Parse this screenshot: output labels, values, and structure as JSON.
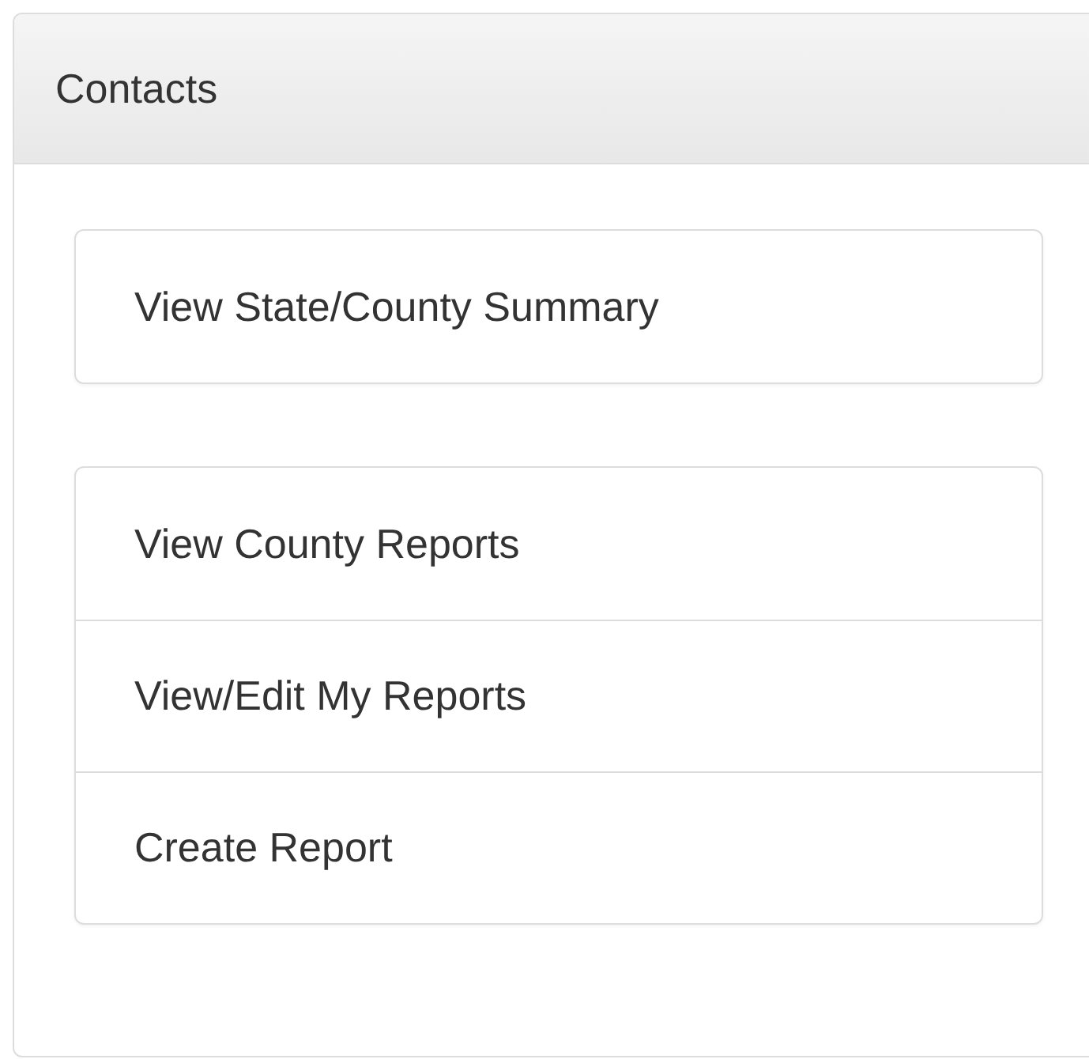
{
  "panel": {
    "title": "Contacts"
  },
  "list_groups": [
    {
      "items": [
        {
          "label": "View State/County Summary"
        }
      ]
    },
    {
      "items": [
        {
          "label": "View County Reports"
        },
        {
          "label": "View/Edit My Reports"
        },
        {
          "label": "Create Report"
        }
      ]
    }
  ]
}
